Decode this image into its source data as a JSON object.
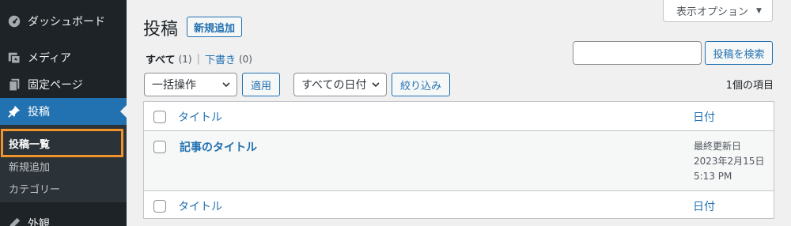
{
  "sidebar": {
    "items": [
      {
        "label": "ダッシュボード",
        "icon": "dashboard-icon"
      },
      {
        "label": "メディア",
        "icon": "media-icon"
      },
      {
        "label": "固定ページ",
        "icon": "pages-icon"
      },
      {
        "label": "投稿",
        "icon": "pin-icon"
      },
      {
        "label": "外観",
        "icon": "appearance-icon"
      }
    ],
    "submenu": [
      "投稿一覧",
      "新規追加",
      "カテゴリー"
    ]
  },
  "screen_options": "表示オプション",
  "page": {
    "title": "投稿",
    "add_new": "新規追加"
  },
  "filters": {
    "all_label": "すべて",
    "all_count": "(1)",
    "separator": "|",
    "drafts_label": "下書き",
    "drafts_count": "(0)"
  },
  "search": {
    "value": "",
    "button": "投稿を検索"
  },
  "bulk": {
    "select": "一括操作",
    "apply": "適用",
    "dates": "すべての日付",
    "filter": "絞り込み",
    "count": "1個の項目"
  },
  "table": {
    "col_title": "タイトル",
    "col_date": "日付",
    "rows": [
      {
        "title": "記事のタイトル",
        "date_status": "最終更新日",
        "date": "2023年2月15日",
        "time": "5:13 PM"
      }
    ]
  },
  "colors": {
    "sidebar_bg": "#1d2327",
    "accent": "#2271b1",
    "highlight": "#f0932a"
  }
}
